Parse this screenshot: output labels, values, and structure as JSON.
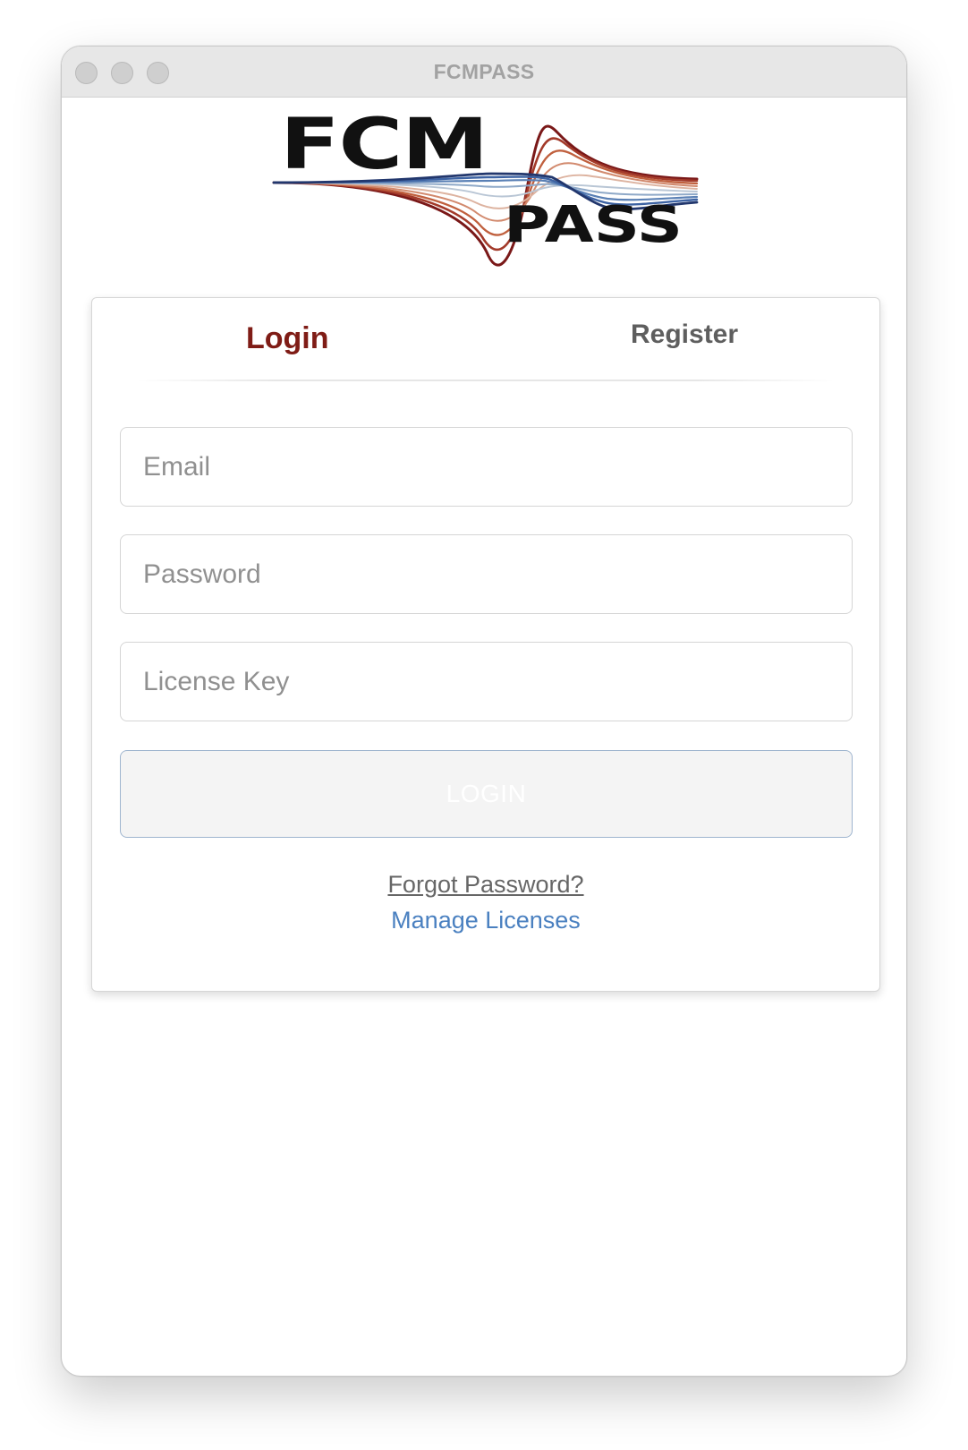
{
  "window": {
    "title": "FCMPASS"
  },
  "logo": {
    "top_text": "FCM",
    "bottom_text": "PASS"
  },
  "tabs": [
    {
      "label": "Login",
      "active": true
    },
    {
      "label": "Register",
      "active": false
    }
  ],
  "form": {
    "email_placeholder": "Email",
    "email_value": "",
    "password_placeholder": "Password",
    "password_value": "",
    "license_placeholder": "License Key",
    "license_value": "",
    "login_button_label": "LOGIN"
  },
  "links": {
    "forgot_password": "Forgot Password?",
    "manage_licenses": "Manage Licenses"
  },
  "colors": {
    "active_tab": "#7f1c16",
    "inactive_tab": "#5e5e5e",
    "link_blue": "#4a80c0",
    "button_border": "#9fb5cf"
  }
}
